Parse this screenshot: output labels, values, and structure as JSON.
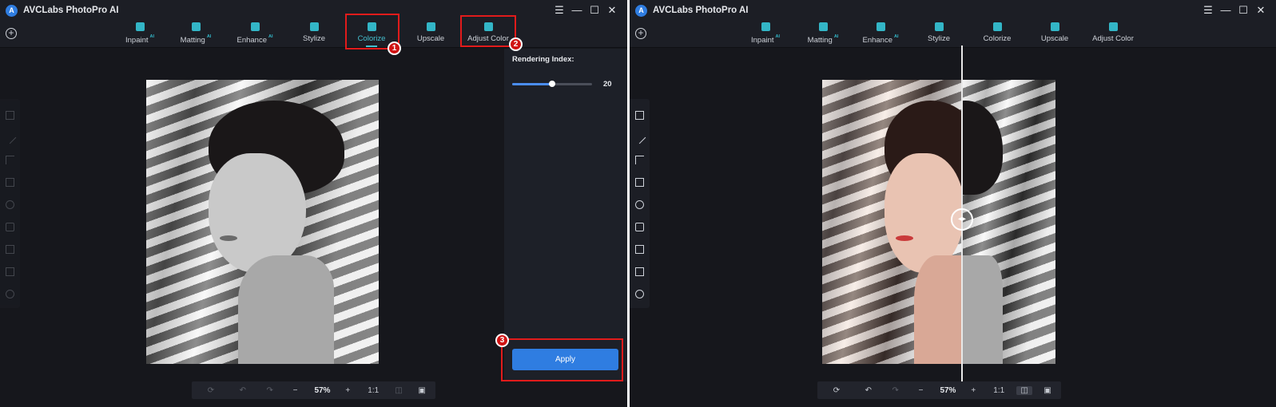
{
  "app": {
    "title": "AVCLabs PhotoPro AI",
    "logo_letter": "A"
  },
  "window_controls": {
    "menu": "☰",
    "minimize": "—",
    "maximize": "☐",
    "close": "✕"
  },
  "toolbar": {
    "add_symbol": "+",
    "tools": [
      {
        "label": "Inpaint",
        "ai": "AI",
        "icon": "inpaint-icon"
      },
      {
        "label": "Matting",
        "ai": "AI",
        "icon": "matting-icon"
      },
      {
        "label": "Enhance",
        "ai": "AI",
        "icon": "enhance-icon"
      },
      {
        "label": "Stylize",
        "icon": "stylize-icon"
      },
      {
        "label": "Colorize",
        "icon": "colorize-icon"
      },
      {
        "label": "Upscale",
        "icon": "upscale-icon"
      },
      {
        "label": "Adjust Color",
        "icon": "adjust-color-icon"
      }
    ]
  },
  "side_tools": [
    "crop-icon",
    "brush-icon",
    "select-icon",
    "rectangle-icon",
    "circle-icon",
    "portrait-icon",
    "text-icon",
    "edit-icon",
    "history-icon"
  ],
  "panel": {
    "title": "Rendering Index:",
    "slider_value": 20,
    "slider_max": 40,
    "apply_label": "Apply"
  },
  "bottom_bar": {
    "reset": "⟳",
    "undo": "↶",
    "redo": "↷",
    "zoom_out": "−",
    "zoom": "57%",
    "zoom_in": "+",
    "actual_size": "1:1",
    "compare": "◫",
    "save": "▣"
  },
  "annotations": {
    "badge_1": "1",
    "badge_2": "2",
    "badge_3": "3"
  },
  "colors": {
    "accent": "#2f7de1",
    "active_teal": "#45c0cf",
    "highlight_red": "#e11b1b",
    "background": "#16171c"
  }
}
